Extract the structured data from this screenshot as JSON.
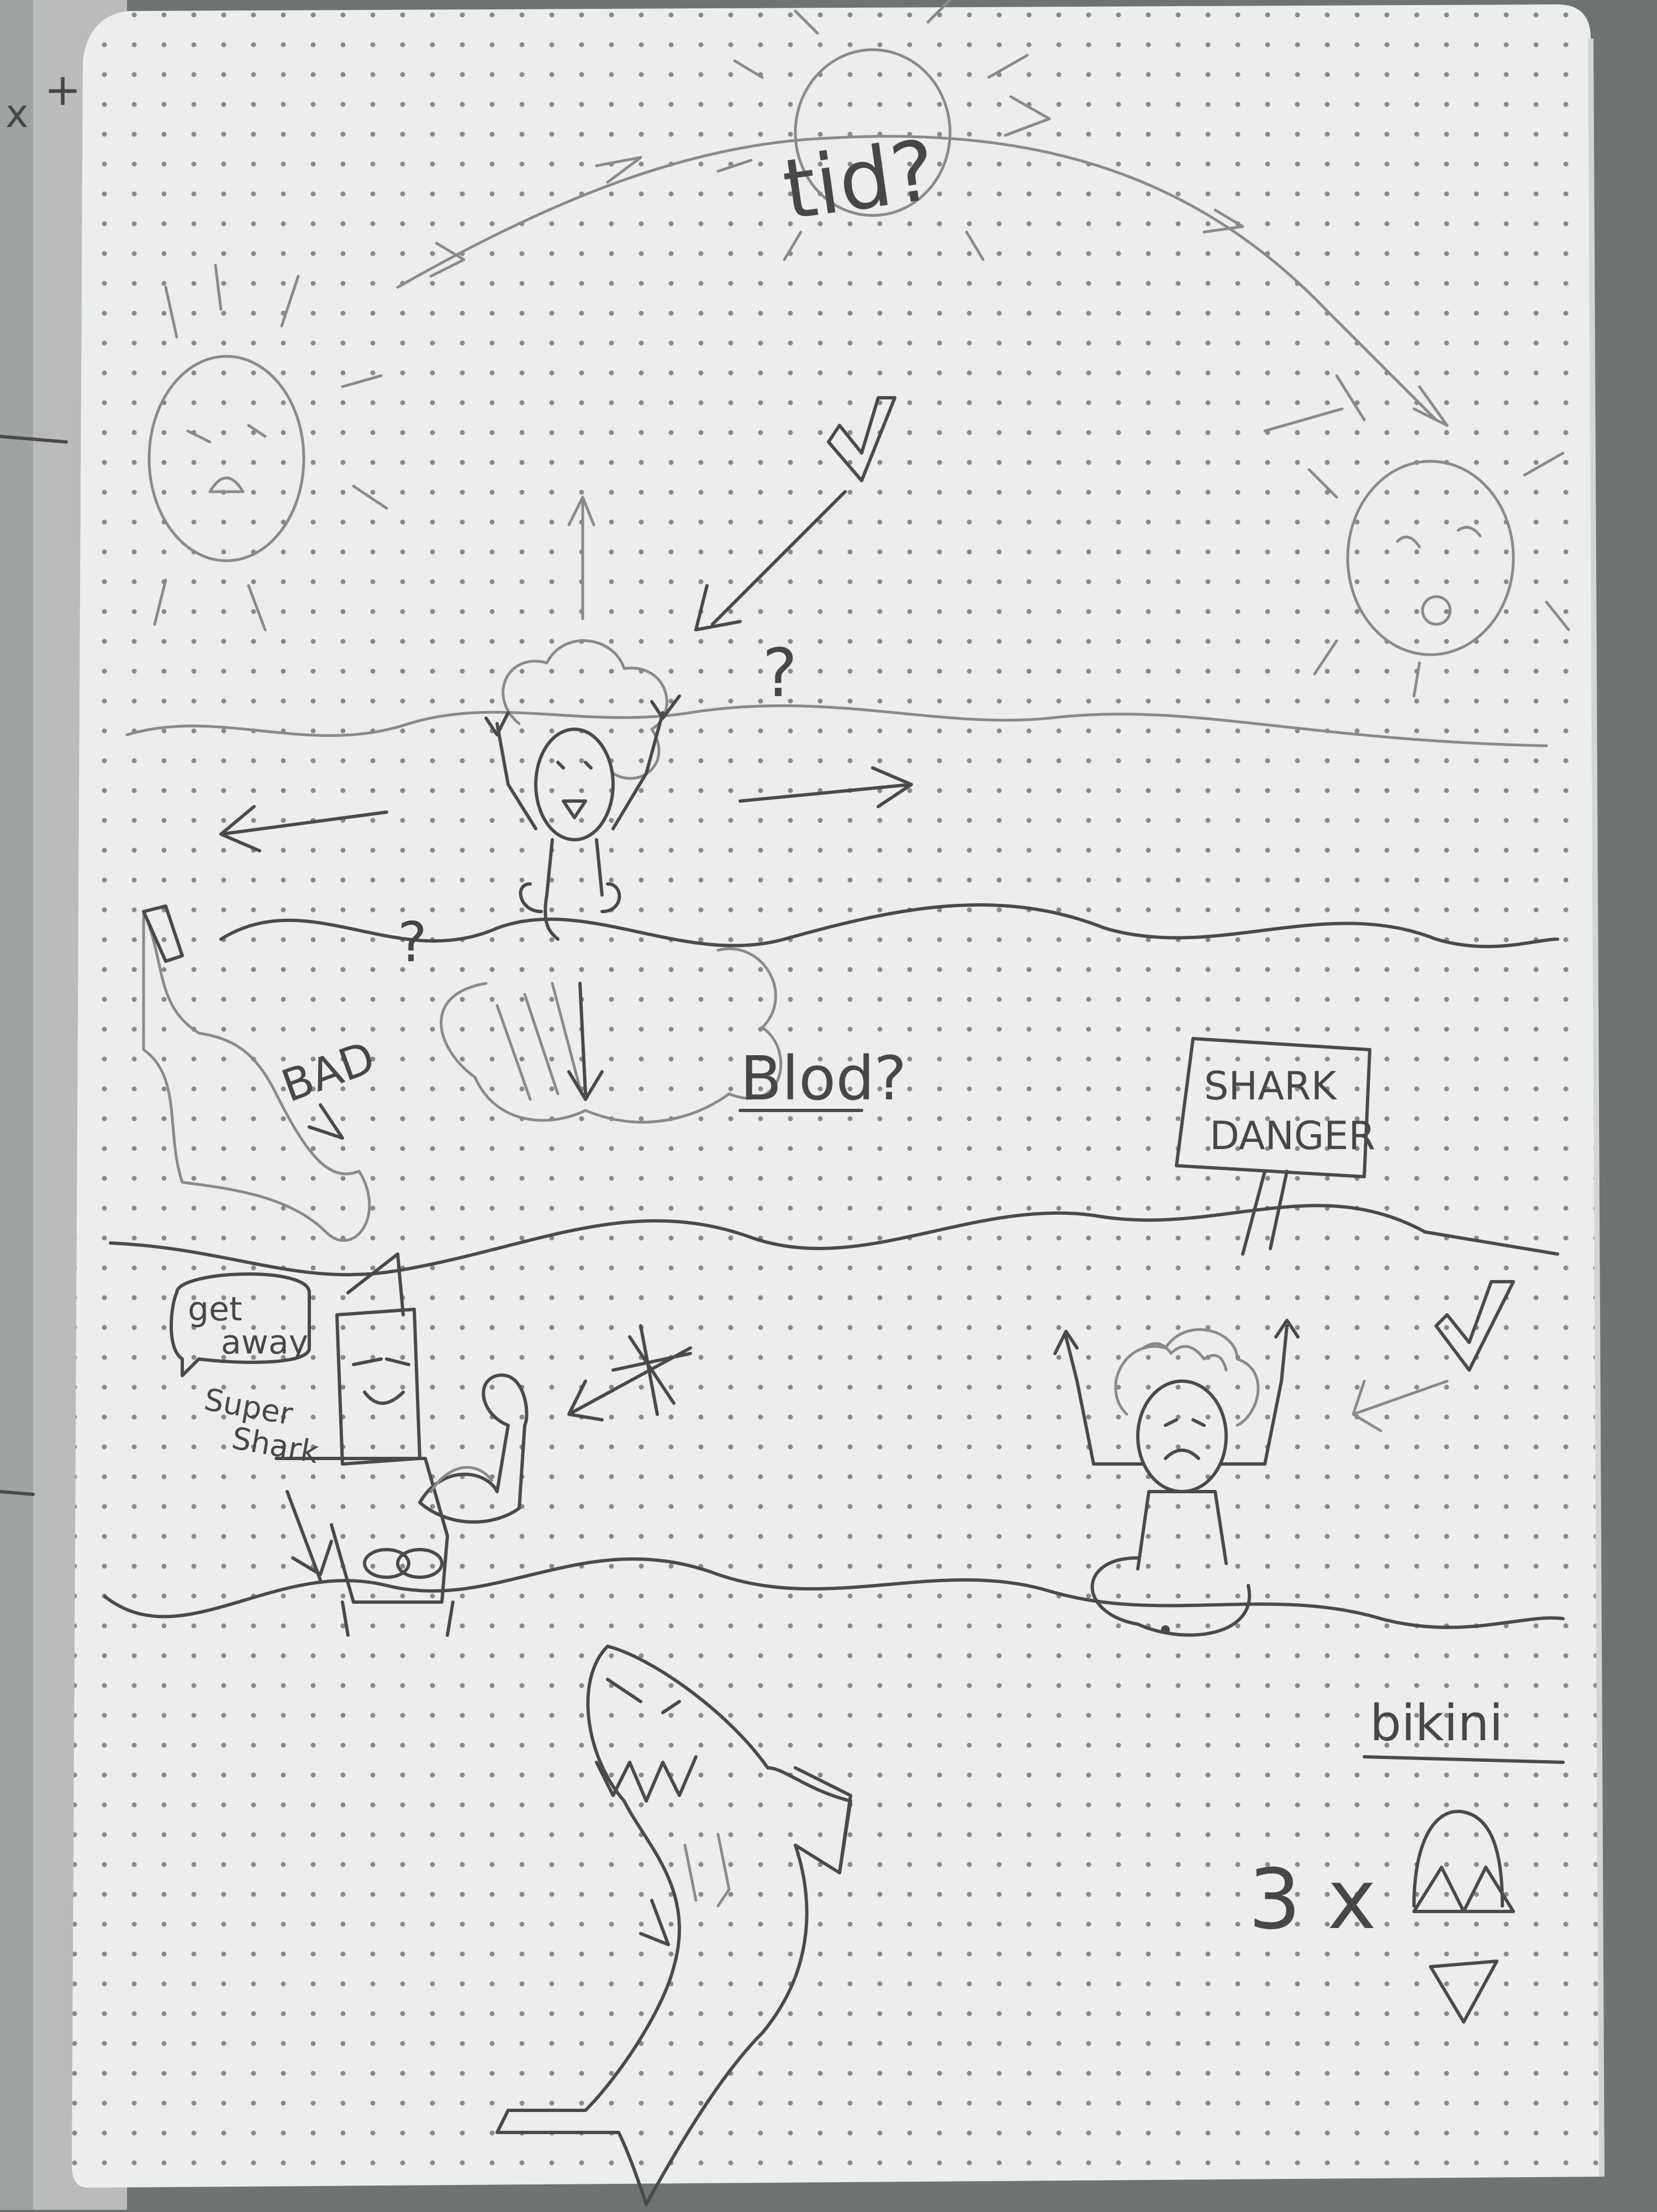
{
  "paper": {
    "background": "#eceeed",
    "binding_color": "#6e7373",
    "dot_color": "#777777",
    "pencil_color": "#4a4a4a"
  },
  "text": {
    "sky_label": "tid?",
    "sky_question": "?",
    "left_question": "?",
    "bad_note": "BAD",
    "cloud_note": "Blod?",
    "sign_line1": "SHARK",
    "sign_line2": "DANGER",
    "bubble_line1": "get",
    "bubble_line2": "away",
    "super_shark_line1": "Super",
    "super_shark_line2": "Shark",
    "bikini_word": "bikini",
    "count": "3 x",
    "margin_scribble": "+",
    "margin_scribble_2": "x"
  },
  "icons": {
    "sun_upper": "sun-icon",
    "sun_left": "sad-sun-icon",
    "sun_right": "laughing-sun-icon",
    "checkmark": "checkmark-icon",
    "shark": "shark-icon",
    "bikini": "bikini-icon",
    "flexed_arm": "flexed-arm-icon"
  }
}
